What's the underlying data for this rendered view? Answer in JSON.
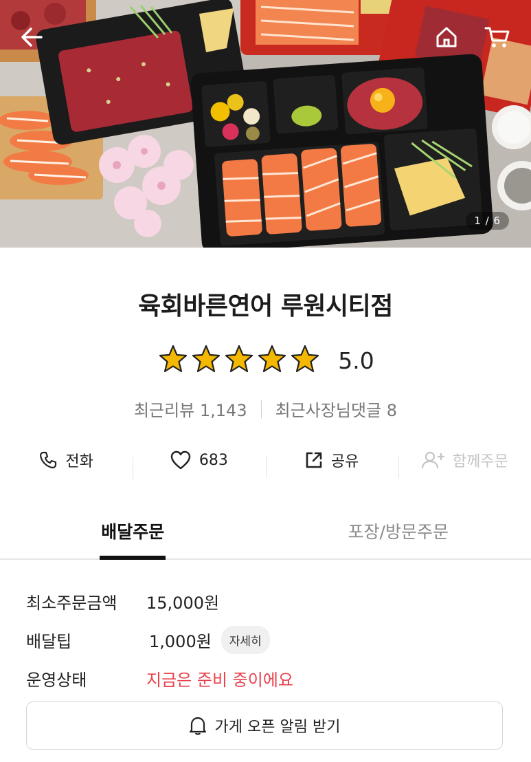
{
  "hero": {
    "image_counter": "1 / 6",
    "icons": {
      "back": "arrow-left-icon",
      "home": "home-icon",
      "cart": "cart-icon"
    }
  },
  "store": {
    "name": "육회바른연어 루원시티점",
    "rating": 5.0,
    "rating_text": "5.0",
    "stars_filled": 5,
    "recent_reviews": "최근리뷰 1,143",
    "owner_replies": "최근사장님댓글 8"
  },
  "actions": [
    {
      "label": "전화",
      "icon": "phone-icon"
    },
    {
      "label": "683",
      "icon": "heart-icon"
    },
    {
      "label": "공유",
      "icon": "share-icon"
    },
    {
      "label": "함께주문",
      "icon": "add-user-icon",
      "disabled": true
    }
  ],
  "tabs": [
    {
      "label": "배달주문",
      "active": true
    },
    {
      "label": "포장/방문주문",
      "active": false
    }
  ],
  "info": {
    "min_order_label": "최소주문금액",
    "min_order_value": "15,000원",
    "delivery_tip_label": "배달팁",
    "delivery_tip_value": "1,000원",
    "detail_button": "자세히",
    "status_label": "운영상태",
    "status_value": "지금은 준비 중이에요"
  },
  "notify_button": {
    "label": "가게 오픈 알림 받기",
    "icon": "bell-icon"
  },
  "colors": {
    "status_red": "#e8424c",
    "star_yellow": "#f5b800"
  }
}
